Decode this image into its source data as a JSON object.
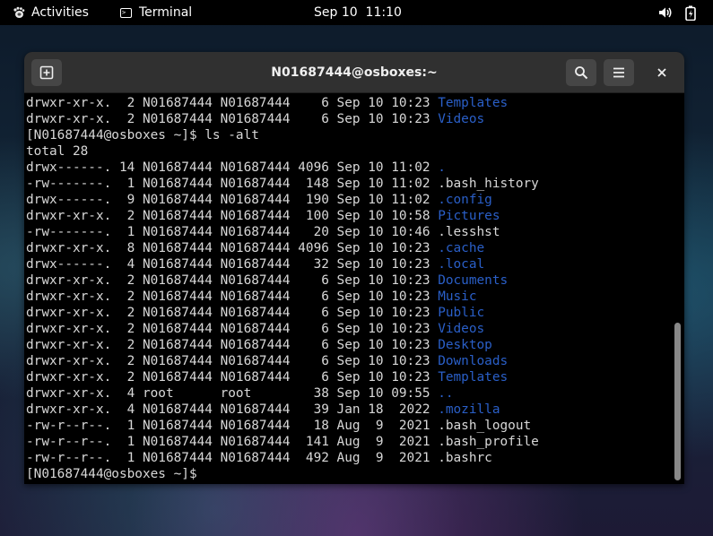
{
  "topbar": {
    "activities_label": "Activities",
    "app_label": "Terminal",
    "clock": "Sep 10  11:10",
    "icons": [
      "gnome-foot-icon",
      "terminal-icon",
      "volume-icon",
      "battery-icon"
    ]
  },
  "window": {
    "title": "N01687444@osboxes:~",
    "icons": [
      "new-tab-icon",
      "search-icon",
      "hamburger-menu-icon",
      "close-icon"
    ]
  },
  "colors": {
    "directory": "#2a5fc8",
    "text": "#d8d8d8",
    "headerbar": "#303030"
  },
  "terminal": {
    "lines": [
      {
        "text": "drwxr-xr-x.  2 N01687444 N01687444    6 Sep 10 10:23 ",
        "name": "Templates",
        "dir": true
      },
      {
        "text": "drwxr-xr-x.  2 N01687444 N01687444    6 Sep 10 10:23 ",
        "name": "Videos",
        "dir": true
      },
      {
        "text": "[N01687444@osboxes ~]$ ls -alt",
        "name": "",
        "dir": false
      },
      {
        "text": "total 28",
        "name": "",
        "dir": false
      },
      {
        "text": "drwx------. 14 N01687444 N01687444 4096 Sep 10 11:02 ",
        "name": ".",
        "dir": true
      },
      {
        "text": "-rw-------.  1 N01687444 N01687444  148 Sep 10 11:02 ",
        "name": ".bash_history",
        "dir": false
      },
      {
        "text": "drwx------.  9 N01687444 N01687444  190 Sep 10 11:02 ",
        "name": ".config",
        "dir": true
      },
      {
        "text": "drwxr-xr-x.  2 N01687444 N01687444  100 Sep 10 10:58 ",
        "name": "Pictures",
        "dir": true
      },
      {
        "text": "-rw-------.  1 N01687444 N01687444   20 Sep 10 10:46 ",
        "name": ".lesshst",
        "dir": false
      },
      {
        "text": "drwxr-xr-x.  8 N01687444 N01687444 4096 Sep 10 10:23 ",
        "name": ".cache",
        "dir": true
      },
      {
        "text": "drwx------.  4 N01687444 N01687444   32 Sep 10 10:23 ",
        "name": ".local",
        "dir": true
      },
      {
        "text": "drwxr-xr-x.  2 N01687444 N01687444    6 Sep 10 10:23 ",
        "name": "Documents",
        "dir": true
      },
      {
        "text": "drwxr-xr-x.  2 N01687444 N01687444    6 Sep 10 10:23 ",
        "name": "Music",
        "dir": true
      },
      {
        "text": "drwxr-xr-x.  2 N01687444 N01687444    6 Sep 10 10:23 ",
        "name": "Public",
        "dir": true
      },
      {
        "text": "drwxr-xr-x.  2 N01687444 N01687444    6 Sep 10 10:23 ",
        "name": "Videos",
        "dir": true
      },
      {
        "text": "drwxr-xr-x.  2 N01687444 N01687444    6 Sep 10 10:23 ",
        "name": "Desktop",
        "dir": true
      },
      {
        "text": "drwxr-xr-x.  2 N01687444 N01687444    6 Sep 10 10:23 ",
        "name": "Downloads",
        "dir": true
      },
      {
        "text": "drwxr-xr-x.  2 N01687444 N01687444    6 Sep 10 10:23 ",
        "name": "Templates",
        "dir": true
      },
      {
        "text": "drwxr-xr-x.  4 root      root        38 Sep 10 09:55 ",
        "name": "..",
        "dir": true
      },
      {
        "text": "drwxr-xr-x.  4 N01687444 N01687444   39 Jan 18  2022 ",
        "name": ".mozilla",
        "dir": true
      },
      {
        "text": "-rw-r--r--.  1 N01687444 N01687444   18 Aug  9  2021 ",
        "name": ".bash_logout",
        "dir": false
      },
      {
        "text": "-rw-r--r--.  1 N01687444 N01687444  141 Aug  9  2021 ",
        "name": ".bash_profile",
        "dir": false
      },
      {
        "text": "-rw-r--r--.  1 N01687444 N01687444  492 Aug  9  2021 ",
        "name": ".bashrc",
        "dir": false
      },
      {
        "text": "[N01687444@osboxes ~]$ ",
        "name": "",
        "dir": false
      }
    ]
  }
}
